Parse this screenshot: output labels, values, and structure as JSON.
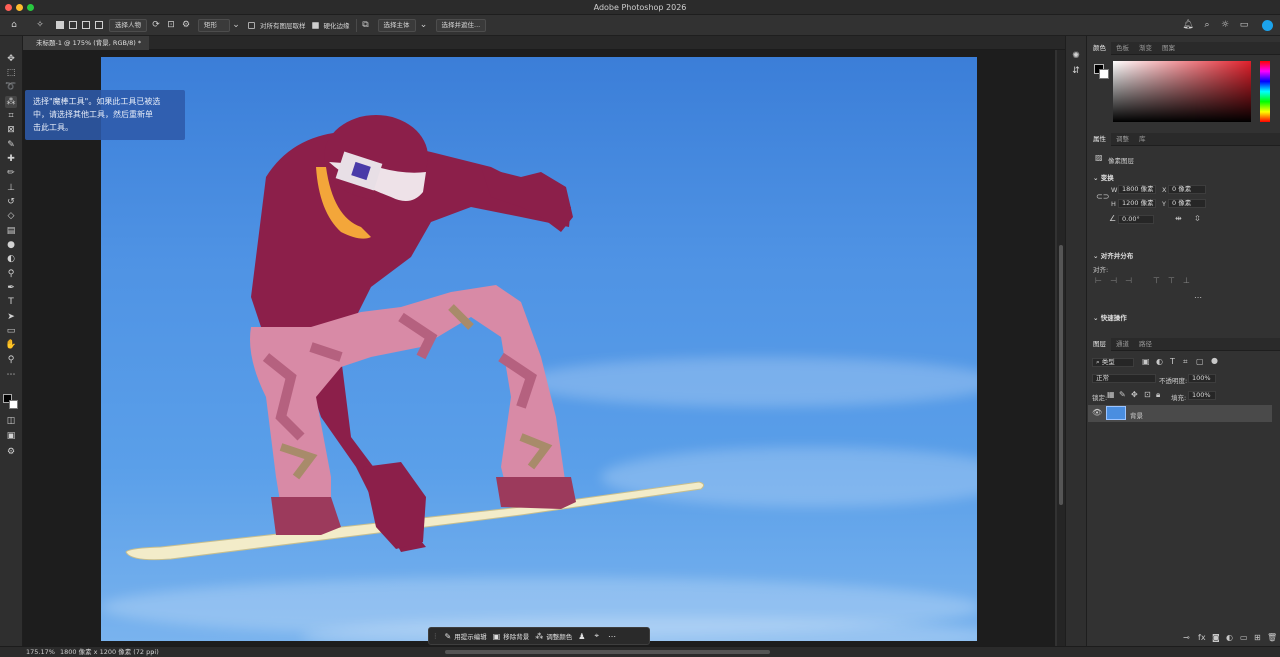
{
  "app": {
    "title": "Adobe Photoshop 2026"
  },
  "traffic_colors": {
    "close": "#fe5f57",
    "min": "#febc2e",
    "max": "#28c840"
  },
  "options": {
    "select_subject_label": "选择人物",
    "mode_label": "矩形",
    "sample_all_label": "对所有图层取样",
    "hard_edge_label": "硬化边缘",
    "select_subject_btn": "选择主体",
    "select_mask_btn": "选择并遮住..."
  },
  "document": {
    "tab_label": "未标题-1 @ 175% (背景, RGB/8) *"
  },
  "tooltip": {
    "line1": "选择\"魔棒工具\"。如果此工具已被选",
    "line2": "中，请选择其他工具，然后重新单",
    "line3": "击此工具。"
  },
  "context_bar": {
    "prompt_edit": "用提示编辑",
    "remove_bg": "移除背景",
    "adjust_color": "调整颜色"
  },
  "status": {
    "zoom": "175.17%",
    "doc_info": "1800 像素 x 1200 像素 (72 ppi)"
  },
  "color_panel": {
    "tabs": [
      "颜色",
      "色板",
      "渐变",
      "图案"
    ]
  },
  "properties_panel": {
    "tabs": [
      "属性",
      "调整",
      "库"
    ],
    "layer_kind": "像素图层",
    "transform_title": "变换",
    "w_label": "W",
    "w_value": "1800 像素",
    "x_label": "X",
    "x_value": "0 像素",
    "h_label": "H",
    "h_value": "1200 像素",
    "y_label": "Y",
    "y_value": "0 像素",
    "angle_value": "0.00°",
    "align_title": "对齐并分布",
    "align_label": "对齐:",
    "quick_title": "快速操作"
  },
  "layers_panel": {
    "tabs": [
      "图层",
      "通道",
      "路径"
    ],
    "filter_kind": "类型",
    "blend_mode": "正常",
    "opacity_label": "不透明度:",
    "opacity_value": "100%",
    "lock_label": "锁定:",
    "fill_label": "填充:",
    "fill_value": "100%",
    "layer_name": "背景"
  }
}
